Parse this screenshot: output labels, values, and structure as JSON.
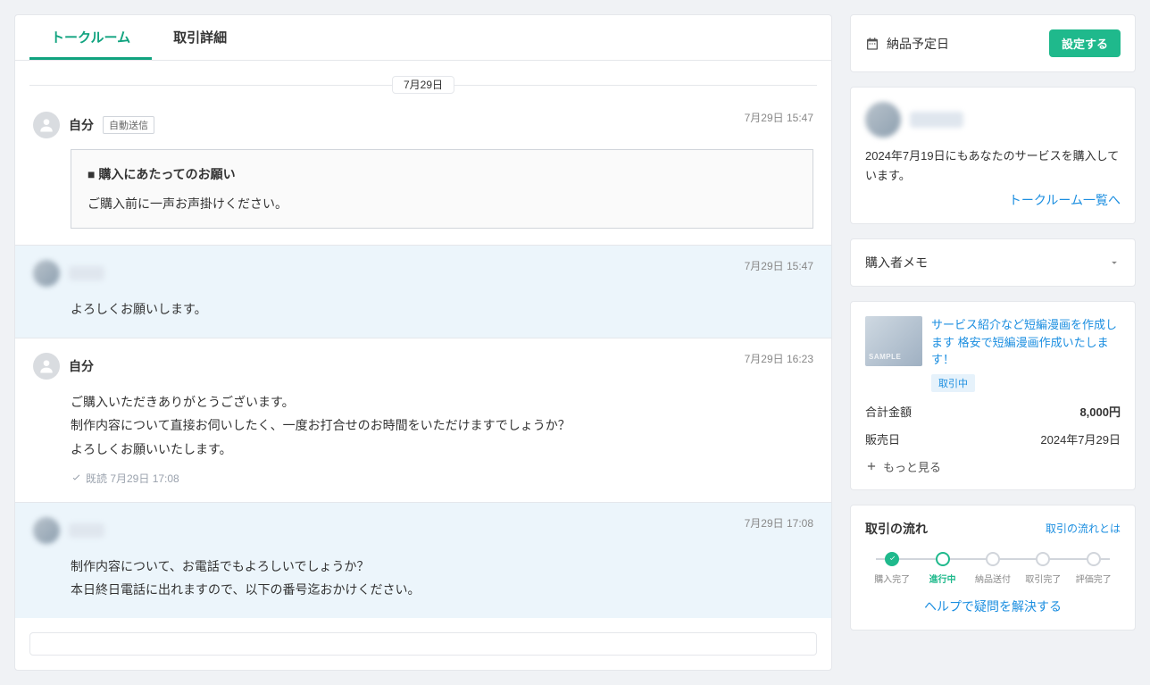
{
  "tabs": {
    "talkroom": "トークルーム",
    "detail": "取引詳細"
  },
  "date_divider": "7月29日",
  "messages": [
    {
      "sender": "自分",
      "auto_tag": "自動送信",
      "time": "7月29日 15:47",
      "note_title": "■ 購入にあたってのお願い",
      "note_body": "ご購入前に一声お声掛けください。"
    },
    {
      "sender_blur": true,
      "time": "7月29日 15:47",
      "body": "よろしくお願いします。"
    },
    {
      "sender": "自分",
      "time": "7月29日 16:23",
      "body": "ご購入いただきありがとうございます。\n制作内容について直接お伺いしたく、一度お打合せのお時間をいただけますでしょうか？\nよろしくお願いいたします。",
      "read": "既読 7月29日 17:08"
    },
    {
      "sender_blur": true,
      "time": "7月29日 17:08",
      "body": "制作内容について、お電話でもよろしいでしょうか？\n本日終日電話に出れますので、以下の番号迄おかけください。"
    }
  ],
  "sidebar": {
    "delivery_label": "納品予定日",
    "configure": "設定する",
    "buyer_history": "2024年7月19日にもあなたのサービスを購入しています。",
    "talkroom_list": "トークルーム一覧へ",
    "memo": "購入者メモ",
    "service_title": "サービス紹介など短編漫画を作成します 格安で短編漫画作成いたします！",
    "status_badge": "取引中",
    "amount_label": "合計金額",
    "amount_value": "8,000円",
    "sold_label": "販売日",
    "sold_value": "2024年7月29日",
    "more": "もっと見る",
    "flow_title": "取引の流れ",
    "flow_link": "取引の流れとは",
    "steps": [
      "購入完了",
      "進行中",
      "納品送付",
      "取引完了",
      "評価完了"
    ],
    "help": "ヘルプで疑問を解決する"
  }
}
